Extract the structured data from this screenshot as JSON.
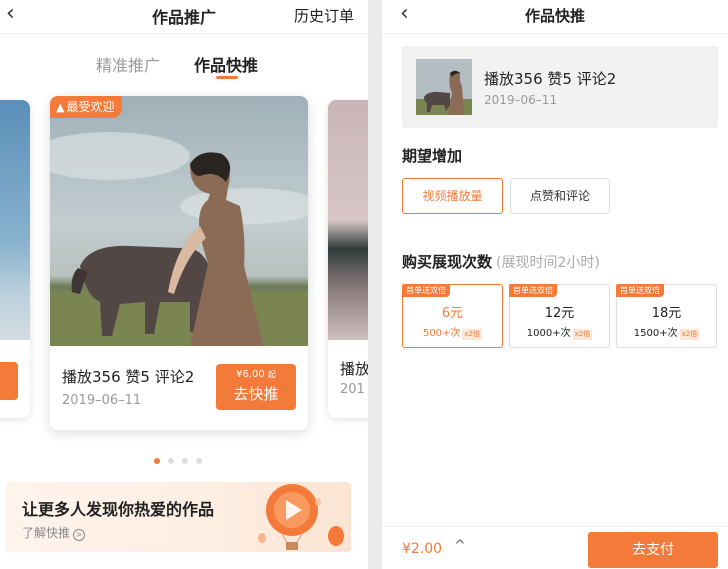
{
  "left": {
    "nav": {
      "back_glyph": "‹",
      "title": "作品推广",
      "history": "历史订单"
    },
    "tabs": [
      {
        "label": "精准推广",
        "active": false
      },
      {
        "label": "作品快推",
        "active": true
      }
    ],
    "main_card": {
      "badge": "最受欢迎",
      "badge_icon": "fire-icon",
      "stats": "播放356 赞5 评论2",
      "date": "2019–06–11",
      "price": "¥6.00",
      "price_suffix": "起",
      "button": "去快推"
    },
    "right_card": {
      "stats_fragment": "播放",
      "date_fragment": "201"
    },
    "carousel": {
      "total": 4,
      "active_index": 0
    },
    "banner": {
      "headline": "让更多人发现你热爱的作品",
      "link": "了解快推",
      "link_icon": ">"
    }
  },
  "right": {
    "nav": {
      "back_glyph": "‹",
      "title": "作品快推"
    },
    "work": {
      "stats": "播放356  赞5  评论2",
      "date": "2019–06–11"
    },
    "expect": {
      "title": "期望增加",
      "options": [
        {
          "label": "视频播放量",
          "selected": true
        },
        {
          "label": "点赞和评论",
          "selected": false
        }
      ]
    },
    "purchase": {
      "title": "购买展现次数",
      "hint": "(展现时间2小时)",
      "packages": [
        {
          "tag": "首单送双倍",
          "amount": "6元",
          "count": "500+次",
          "multiplier": "x2倍",
          "selected": true
        },
        {
          "tag": "首单送双倍",
          "amount": "12元",
          "count": "1000+次",
          "multiplier": "x2倍",
          "selected": false
        },
        {
          "tag": "首单送双倍",
          "amount": "18元",
          "count": "1500+次",
          "multiplier": "x2倍",
          "selected": false
        }
      ]
    },
    "footer": {
      "total": "¥2.00",
      "caret": "^",
      "pay_button": "去支付"
    }
  },
  "colors": {
    "accent": "#f47a3a",
    "muted": "#999999",
    "text": "#222222",
    "tag_bg": "#fde6d6"
  }
}
